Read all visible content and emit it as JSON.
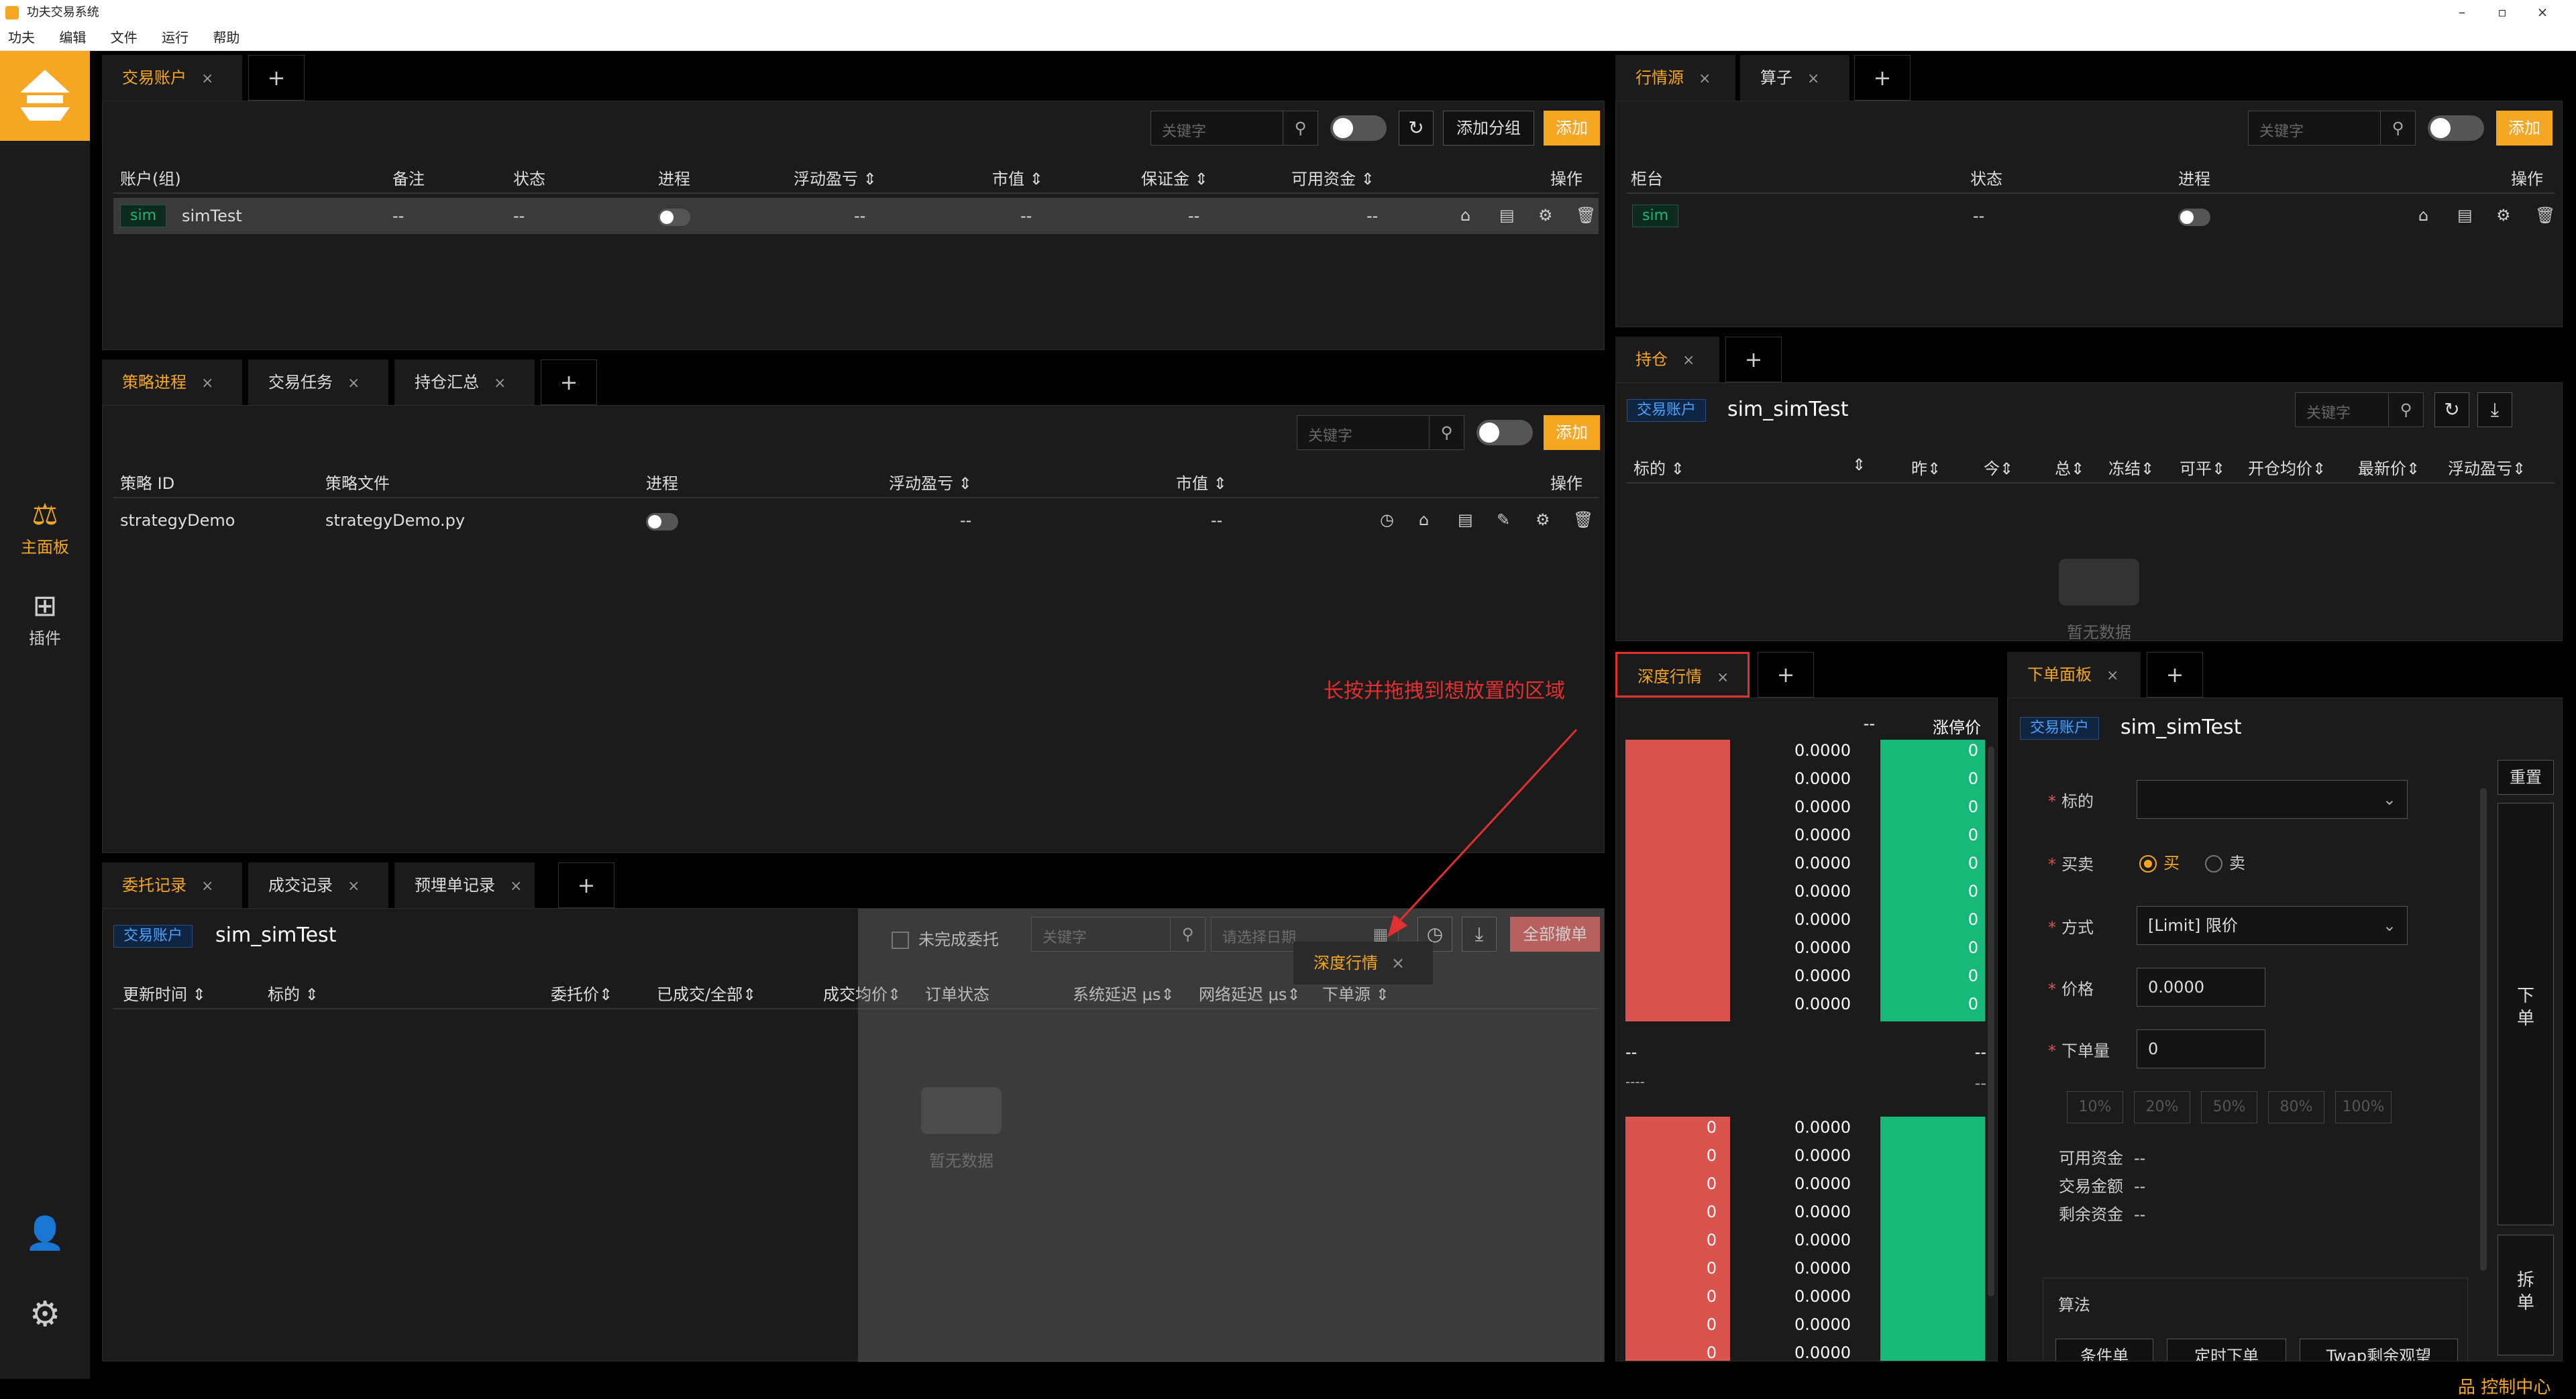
{
  "window": {
    "title": "功夫交易系统",
    "minimize": "–",
    "restore": "▫",
    "close": "×"
  },
  "menu": [
    "功夫",
    "编辑",
    "文件",
    "运行",
    "帮助"
  ],
  "sidebar": {
    "items": [
      {
        "label": "主面板",
        "icon": "dashboard-icon",
        "glyph": "⚖"
      },
      {
        "label": "插件",
        "icon": "plugin-icon",
        "glyph": "⊞"
      }
    ],
    "user_glyph": "👤",
    "settings_glyph": "⚙"
  },
  "icons": {
    "search": "⚲",
    "refresh": "↻",
    "download": "⤓",
    "calendar": "▦",
    "clock": "◷",
    "bank": "⌂",
    "file": "▤",
    "gear": "⚙",
    "trash": "🗑",
    "edit": "✎",
    "chev": "⌄"
  },
  "accounts_panel": {
    "tabs": [
      {
        "label": "交易账户",
        "close": "×"
      }
    ],
    "plus": "+",
    "search_placeholder": "关键字",
    "add_group": "添加分组",
    "add": "添加",
    "columns": [
      "账户(组)",
      "备注",
      "状态",
      "进程",
      "浮动盈亏 ⇕",
      "市值 ⇕",
      "保证金 ⇕",
      "可用资金 ⇕",
      "操作"
    ],
    "rows": [
      {
        "tag": "sim",
        "name": "simTest",
        "remark": "--",
        "status": "--",
        "pnl": "--",
        "market": "--",
        "margin": "--",
        "avail": "--"
      }
    ]
  },
  "md_panel": {
    "tabs": [
      {
        "label": "行情源",
        "close": "×"
      },
      {
        "label": "算子",
        "close": "×"
      }
    ],
    "plus": "+",
    "search_placeholder": "关键字",
    "add": "添加",
    "columns": [
      "柜台",
      "状态",
      "进程",
      "操作"
    ],
    "rows": [
      {
        "tag": "sim",
        "status": "--"
      }
    ]
  },
  "strategy_panel": {
    "tabs": [
      {
        "label": "策略进程",
        "close": "×"
      },
      {
        "label": "交易任务",
        "close": "×"
      },
      {
        "label": "持仓汇总",
        "close": "×"
      }
    ],
    "plus": "+",
    "search_placeholder": "关键字",
    "add": "添加",
    "columns": [
      "策略 ID",
      "策略文件",
      "进程",
      "浮动盈亏 ⇕",
      "市值 ⇕",
      "操作"
    ],
    "rows": [
      {
        "id": "strategyDemo",
        "file": "strategyDemo.py",
        "pnl": "--",
        "market": "--"
      }
    ]
  },
  "positions_panel": {
    "tabs": [
      {
        "label": "持仓",
        "close": "×"
      }
    ],
    "plus": "+",
    "account_tag": "交易账户",
    "account_name": "sim_simTest",
    "search_placeholder": "关键字",
    "columns": [
      "标的 ⇕",
      "⇕",
      "昨⇕",
      "今⇕",
      "总⇕",
      "冻结⇕",
      "可平⇕",
      "开仓均价⇕",
      "最新价⇕",
      "浮动盈亏⇕"
    ],
    "empty": "暂无数据"
  },
  "orders_panel": {
    "tabs": [
      {
        "label": "委托记录",
        "close": "×"
      },
      {
        "label": "成交记录",
        "close": "×"
      },
      {
        "label": "预埋单记录",
        "close": "×"
      }
    ],
    "plus": "+",
    "account_tag": "交易账户",
    "account_name": "sim_simTest",
    "unfinished_label": "未完成委托",
    "search_placeholder": "关键字",
    "date_placeholder": "请选择日期",
    "cancel_all": "全部撤单",
    "columns": [
      "更新时间 ⇕",
      "标的 ⇕",
      "委托价⇕",
      "已成交/全部⇕",
      "成交均价⇕",
      "订单状态",
      "系统延迟 μs⇕",
      "网络延迟 μs⇕",
      "下单源 ⇕"
    ],
    "empty": "暂无数据"
  },
  "drag_hint": {
    "ghost_tab": "深度行情",
    "ghost_close": "×",
    "annotation": "长按并拖拽到想放置的区域"
  },
  "depth_panel": {
    "tabs": [
      {
        "label": "深度行情",
        "close": "×"
      }
    ],
    "plus": "+",
    "header_left": "--",
    "header_right": "涨停价",
    "ask_prices": [
      "0.0000",
      "0.0000",
      "0.0000",
      "0.0000",
      "0.0000",
      "0.0000",
      "0.0000",
      "0.0000",
      "0.0000",
      "0.0000"
    ],
    "ask_vols": [
      "0",
      "0",
      "0",
      "0",
      "0",
      "0",
      "0",
      "0",
      "0",
      "0"
    ],
    "mid_left": "--",
    "mid_right": "--",
    "mid_left2": "----",
    "mid_right2": "--",
    "bid_prices": [
      "0.0000",
      "0.0000",
      "0.0000",
      "0.0000",
      "0.0000",
      "0.0000",
      "0.0000",
      "0.0000",
      "0.0000"
    ],
    "bid_vols": [
      "0",
      "0",
      "0",
      "0",
      "0",
      "0",
      "0",
      "0",
      "0"
    ]
  },
  "order_panel": {
    "tabs": [
      {
        "label": "下单面板",
        "close": "×"
      }
    ],
    "plus": "+",
    "account_tag": "交易账户",
    "account_name": "sim_simTest",
    "reset": "重置",
    "instrument_label": "标的",
    "side_label": "买卖",
    "buy": "买",
    "sell": "卖",
    "type_label": "方式",
    "type_value": "[Limit] 限价",
    "price_label": "价格",
    "price_value": "0.0000",
    "qty_label": "下单量",
    "qty_value": "0",
    "pcts": [
      "10%",
      "20%",
      "50%",
      "80%",
      "100%"
    ],
    "avail_label": "可用资金",
    "amount_label": "交易金额",
    "remain_label": "剩余资金",
    "avail_value": "--",
    "amount_value": "--",
    "remain_value": "--",
    "place_order": "下\n单",
    "split_order": "拆\n单",
    "algo_title": "算法",
    "algo_buttons": [
      "条件单",
      "定时下单",
      "Twap剩余观望"
    ]
  },
  "status": {
    "control_center": "控制中心"
  },
  "colors": {
    "accent": "#f5a623",
    "red": "#d9534f",
    "green": "#17b978",
    "blue": "#4aa3ff"
  }
}
